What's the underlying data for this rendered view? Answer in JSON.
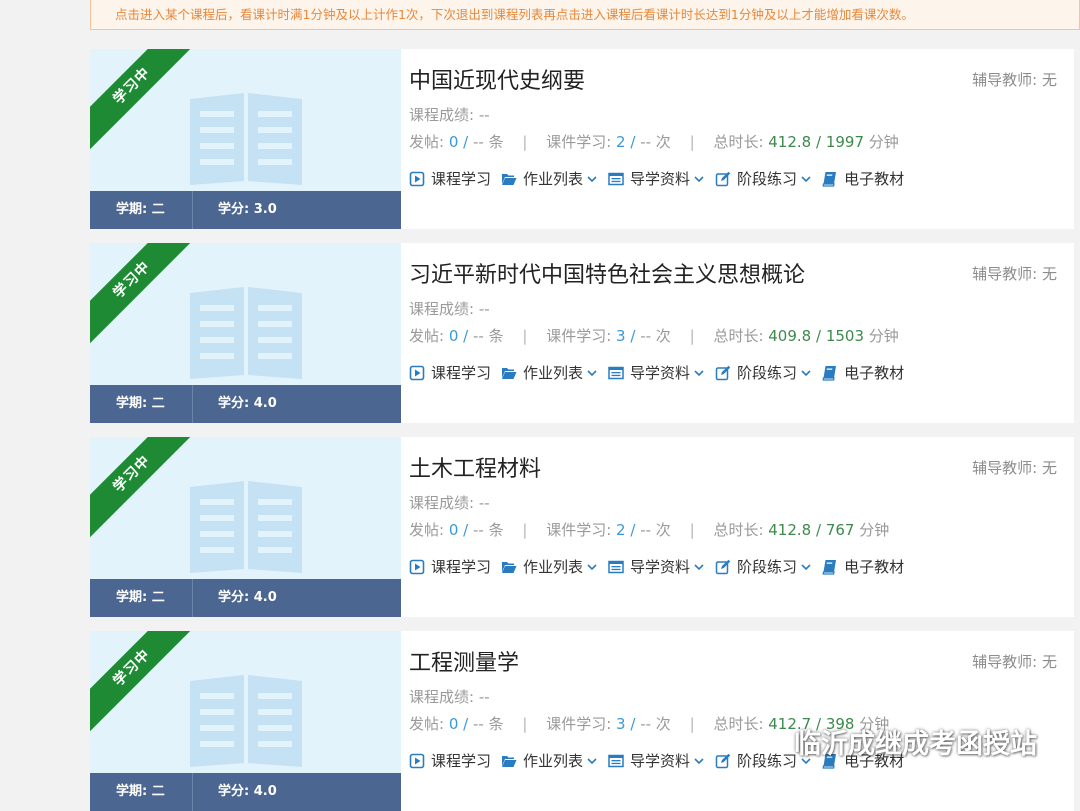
{
  "notice": "点击进入某个课程后，看课计时满1分钟及以上计作1次，下次退出到课程列表再点击进入课程后看课计时长达到1分钟及以上才能增加看课次数。",
  "labels": {
    "status_badge": "学习中",
    "term_prefix": "学期: ",
    "credit_prefix": "学分: ",
    "grade_label": "课程成绩: --",
    "posts_label": "发帖: ",
    "courseware_label": "课件学习: ",
    "duration_label": "总时长: ",
    "tutor_label": "辅导教师: ",
    "posts_unit": "条",
    "courseware_unit": "次",
    "duration_unit": "分钟"
  },
  "menu": {
    "course_study": "课程学习",
    "homework_list": "作业列表",
    "guide_material": "导学资料",
    "stage_practice": "阶段练习",
    "ebook": "电子教材"
  },
  "courses": [
    {
      "title": "中国近现代史纲要",
      "tutor": "无",
      "term": "二",
      "credit": "3.0",
      "posts_done": "0",
      "posts_total": "--",
      "courseware_done": "2",
      "courseware_total": "--",
      "duration_done": "412.8",
      "duration_total": "1997"
    },
    {
      "title": "习近平新时代中国特色社会主义思想概论",
      "tutor": "无",
      "term": "二",
      "credit": "4.0",
      "posts_done": "0",
      "posts_total": "--",
      "courseware_done": "3",
      "courseware_total": "--",
      "duration_done": "409.8",
      "duration_total": "1503"
    },
    {
      "title": "土木工程材料",
      "tutor": "无",
      "term": "二",
      "credit": "4.0",
      "posts_done": "0",
      "posts_total": "--",
      "courseware_done": "2",
      "courseware_total": "--",
      "duration_done": "412.8",
      "duration_total": "767"
    },
    {
      "title": "工程测量学",
      "tutor": "无",
      "term": "二",
      "credit": "4.0",
      "posts_done": "0",
      "posts_total": "--",
      "courseware_done": "3",
      "courseware_total": "--",
      "duration_done": "412.7",
      "duration_total": "398"
    }
  ],
  "watermark": "临沂成继成考函授站",
  "colors": {
    "ribbon": "#1e8a34",
    "term_bar": "#4b6690",
    "link": "#3a9ad8",
    "duration": "#3d8a4c",
    "notice_text": "#e8883c"
  },
  "icons": {
    "course_study": "play-square-icon",
    "homework_list": "folder-open-icon",
    "guide_material": "list-window-icon",
    "stage_practice": "edit-icon",
    "ebook": "book-icon"
  }
}
